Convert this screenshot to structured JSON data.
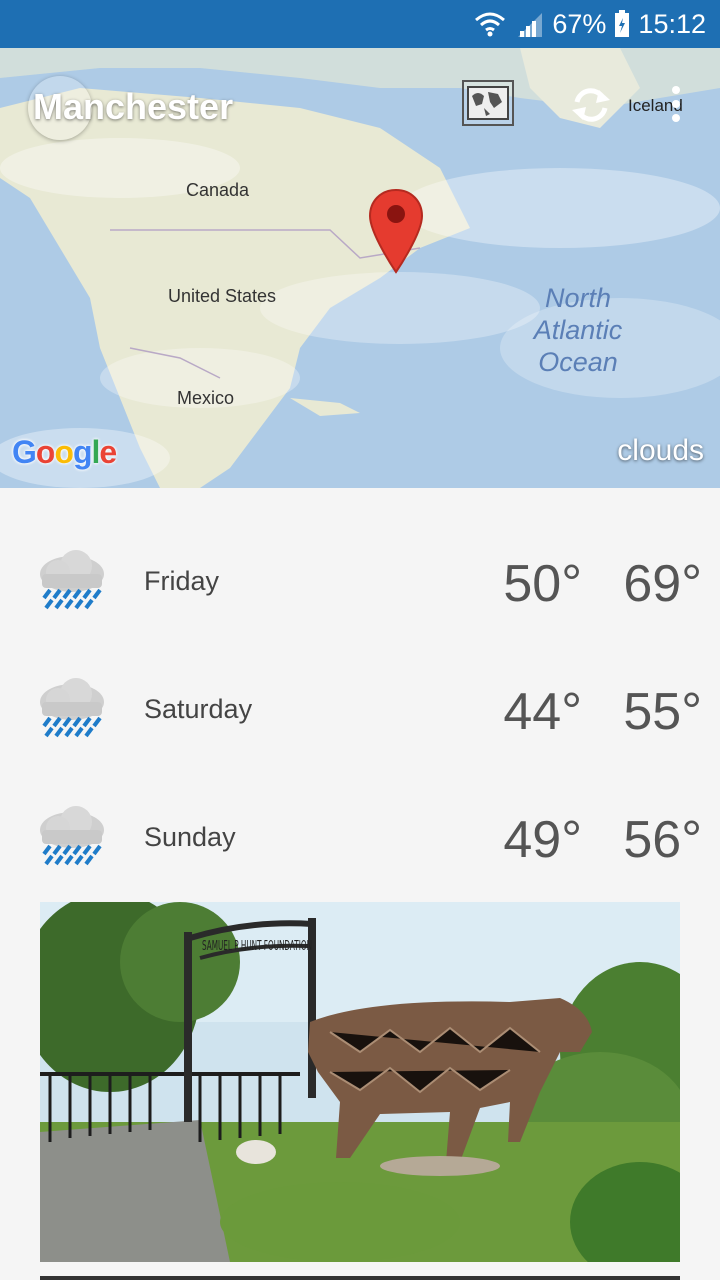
{
  "status_bar": {
    "battery": "67%",
    "time": "15:12"
  },
  "header": {
    "city": "Manchester",
    "map_labels": {
      "canada": "Canada",
      "united_states": "United States",
      "mexico": "Mexico",
      "ocean": "North Atlantic Ocean",
      "iceland": "Iceland"
    },
    "google": "Google",
    "condition": "clouds"
  },
  "forecast": [
    {
      "day": "Friday",
      "low": "50°",
      "high": "69°",
      "icon": "rain-icon"
    },
    {
      "day": "Saturday",
      "low": "44°",
      "high": "55°",
      "icon": "rain-icon"
    },
    {
      "day": "Sunday",
      "low": "49°",
      "high": "56°",
      "icon": "rain-icon"
    }
  ],
  "photo": {
    "sign_text": "SAMUEL P HUNT FOUNDATION"
  }
}
